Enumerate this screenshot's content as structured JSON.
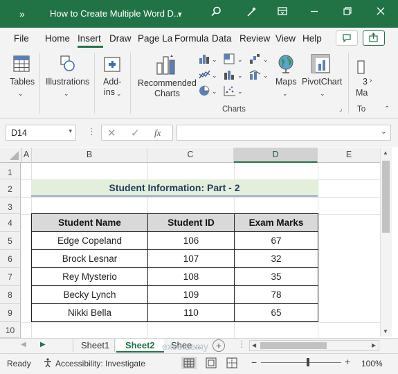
{
  "titlebar": {
    "title": "How to Create Multiple Word D...",
    "dropdown": "▾",
    "icons": [
      "more-icon",
      "search-icon",
      "magic-icon",
      "ribbon-display-icon",
      "minimize-icon"
    ]
  },
  "menu": {
    "tabs": [
      "File",
      "Home",
      "Insert",
      "Draw",
      "Page La",
      "Formula",
      "Data",
      "Review",
      "View",
      "Help"
    ],
    "active": "Insert"
  },
  "ribbon": {
    "groups": {
      "tables": "Tables",
      "illustrations": "Illustrations",
      "addins_line1": "Add-",
      "addins_line2": "ins",
      "recommended_charts_line1": "Recommended",
      "recommended_charts_line2": "Charts",
      "maps": "Maps",
      "pivotchart": "PivotChart",
      "cut_line1": "3",
      "cut_line2": "Ma",
      "charts_group": "Charts",
      "tour_group": "To"
    }
  },
  "formula_bar": {
    "namebox": "D14",
    "fx": "fx",
    "value": ""
  },
  "grid": {
    "columns": [
      "A",
      "B",
      "C",
      "D",
      "E"
    ],
    "selected_column": "D",
    "rows": [
      "1",
      "2",
      "3",
      "4",
      "5",
      "6",
      "7",
      "8",
      "9",
      "10"
    ],
    "banner": "Student Information: Part - 2",
    "table": {
      "headers": [
        "Student Name",
        "Student ID",
        "Exam Marks"
      ],
      "rows": [
        [
          "Edge Copeland",
          "106",
          "67"
        ],
        [
          "Brock Lesnar",
          "107",
          "32"
        ],
        [
          "Rey Mysterio",
          "108",
          "35"
        ],
        [
          "Becky Lynch",
          "109",
          "78"
        ],
        [
          "Nikki Bella",
          "110",
          "65"
        ]
      ]
    }
  },
  "sheets": {
    "tabs": [
      "Sheet1",
      "Sheet2",
      "Shee ..."
    ],
    "active": "Sheet2"
  },
  "status": {
    "ready": "Ready",
    "accessibility": "Accessibility: Investigate",
    "zoom": "100%"
  },
  "watermark": "exceldemy"
}
